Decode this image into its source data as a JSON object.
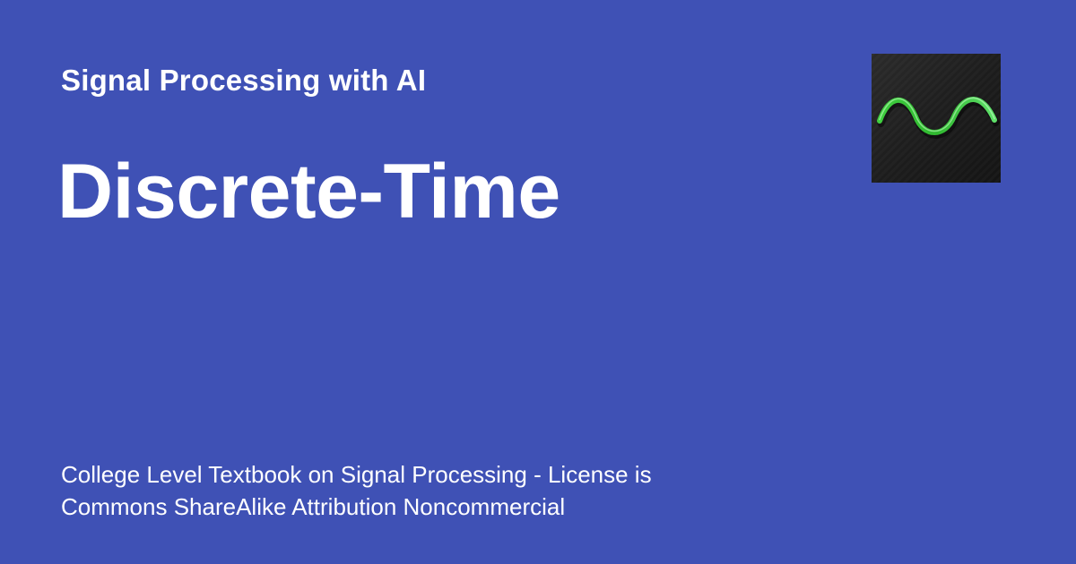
{
  "background_color": "#3f51b5",
  "site": {
    "name": "Signal Processing with AI"
  },
  "page": {
    "title": "Discrete-Time",
    "description_lines": [
      "College Level Textbook on Signal Processing - License is",
      "Commons ShareAlike Attribution Noncommercial"
    ]
  },
  "logo": {
    "icon": "sine-wave-icon",
    "tile_color": "#1e1e1e",
    "wave_color": "#4cd964"
  }
}
